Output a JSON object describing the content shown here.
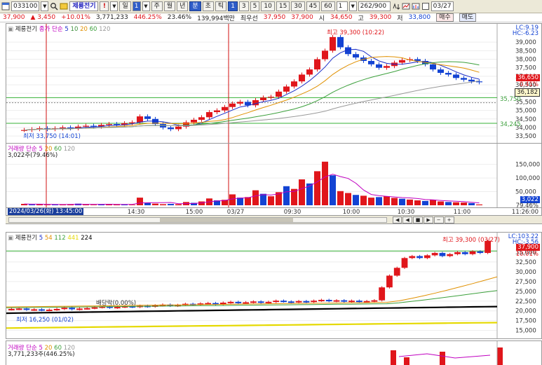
{
  "toolbar": {
    "code": "033100",
    "stock_name": "제룡전기",
    "interval_value": "1",
    "period_buttons": [
      "일",
      "주",
      "월",
      "년",
      "분",
      "초",
      "틱"
    ],
    "minute_buttons": [
      "1",
      "3",
      "5",
      "10",
      "15",
      "30",
      "45",
      "60"
    ],
    "count_value": "1",
    "position": "262/900",
    "date_value": "03/27"
  },
  "quote": {
    "price": "37,900",
    "change": "▲ 3,450",
    "change_pct": "+10.01%",
    "volume": "3,771,233",
    "volume_pct": "446.25%",
    "turnover_pct": "23.46%",
    "amount": "139,994백만",
    "high_label": "최우선",
    "ask": "37,950",
    "bid": "37,900",
    "open_label": "시",
    "open": "34,650",
    "high_label2": "고",
    "high": "39,300",
    "low_label": "저",
    "low": "33,800",
    "buy_label": "매수",
    "sell_label": "매도"
  },
  "top_chart": {
    "legend_name": "제룡전기",
    "legend_ma": "종가 단순",
    "legend_periods": [
      "5",
      "10",
      "20",
      "60",
      "120"
    ],
    "high_annotation": "최고 39,300 (10:22)",
    "low_annotation": "최저 33,750 (14:01)",
    "lc_label": "LC:9.19",
    "hc_label": "HC:-6.23",
    "price_axis": [
      "39,000",
      "38,500",
      "38,000",
      "37,500",
      "37,000",
      "36,500",
      "36,000",
      "35,500",
      "35,000",
      "34,500",
      "34,000",
      "33,500"
    ],
    "current_price_tag": "36,650",
    "current_pct_tag": "0.41%",
    "ref_tag": "36,182",
    "line_35750": "35,750",
    "line_34245": "34,245",
    "chart_data": {
      "type": "line",
      "title": "",
      "series": [
        {
          "name": "",
          "values": [
            33850,
            33900,
            33950,
            33900,
            33950,
            34000,
            33950,
            34050,
            34100,
            34050,
            34150,
            34200,
            34150,
            34250,
            34300,
            34650,
            34500,
            34200,
            34000,
            33900,
            34050,
            34300,
            34450,
            34600,
            34900,
            35000,
            35200,
            35400,
            35500,
            35300,
            35600,
            35750,
            35800,
            36100,
            36400,
            36700,
            37100,
            37400,
            38000,
            38500,
            39300,
            38700,
            38300,
            38100,
            37900,
            37700,
            37500,
            37600,
            37800,
            37950,
            38000,
            37900,
            37700,
            37400,
            37200,
            37100,
            36900,
            36800,
            36700,
            36650
          ]
        }
      ],
      "ylim": [
        33300,
        39500
      ]
    }
  },
  "volume_chart": {
    "legend_name": "거래량",
    "legend_ma": "단순",
    "legend_periods": [
      "5",
      "20",
      "60",
      "120"
    ],
    "legend_value": "3,022주(79.46%)",
    "axis": [
      "150,000",
      "100,000",
      "50,000"
    ],
    "current_tag": "3,022",
    "current_pct": "79.46%",
    "chart_data": {
      "type": "bar",
      "values": [
        5000,
        3000,
        4000,
        2000,
        3000,
        2500,
        4000,
        6000,
        3000,
        2000,
        3000,
        5000,
        4000,
        3000,
        2000,
        28000,
        9000,
        6000,
        4000,
        5000,
        4000,
        12000,
        9000,
        14000,
        25000,
        18000,
        20000,
        40000,
        28000,
        30000,
        55000,
        42000,
        33000,
        48000,
        70000,
        60000,
        95000,
        80000,
        125000,
        160000,
        110000,
        52000,
        45000,
        38000,
        35000,
        28000,
        30000,
        33000,
        27000,
        24000,
        21000,
        18000,
        16000,
        20000,
        14000,
        12000,
        11000,
        10000,
        8000,
        3022
      ]
    }
  },
  "time_axis": {
    "cursor_label": "2024/03/26(화) 13:45:00",
    "ticks": [
      "14:00",
      "14:30",
      "15:00",
      "03/27",
      "09:30",
      "10:00",
      "10:30",
      "11:00",
      "11:26:00"
    ]
  },
  "daily_chart": {
    "legend_name": "제룡전기",
    "legend_periods": [
      "5",
      "54",
      "112",
      "441",
      "224"
    ],
    "high_annotation": "최고 39,300 (03/27)",
    "low_annotation": "최저 16,250 (01/02)",
    "dividend_label": "배당락(0.00%)",
    "lc_label": "LC:103.22",
    "hc_label": "HC:-3.56",
    "price_axis": [
      "35,000",
      "32,500",
      "30,000",
      "27,500",
      "25,000",
      "22,500",
      "20,000",
      "17,500",
      "15,000"
    ],
    "current_tag": "37,900",
    "current_pct": "10.01%",
    "chart_data": {
      "type": "bar",
      "values": [
        20500,
        20600,
        20300,
        20400,
        20200,
        20300,
        20500,
        20800,
        20400,
        20600,
        20700,
        20900,
        21100,
        20800,
        21000,
        21200,
        21000,
        21300,
        21100,
        21400,
        21600,
        21300,
        21500,
        21800,
        21600,
        21900,
        22000,
        21700,
        22100,
        22300,
        22000,
        22200,
        22400,
        22100,
        22300,
        22600,
        22400,
        22200,
        22500,
        22300,
        22600,
        22800,
        22500,
        22700,
        22400,
        22600,
        22300,
        22500,
        22700,
        26000,
        29000,
        31000,
        33500,
        34000,
        33500,
        34200,
        34800,
        34000,
        34500,
        35000,
        34500,
        35200,
        34800,
        37900
      ]
    }
  },
  "daily_volume": {
    "legend_name": "거래량",
    "legend_ma": "단순",
    "legend_periods": [
      "5",
      "20",
      "60",
      "120"
    ],
    "legend_value": "3,771,233주(446.25%)"
  }
}
